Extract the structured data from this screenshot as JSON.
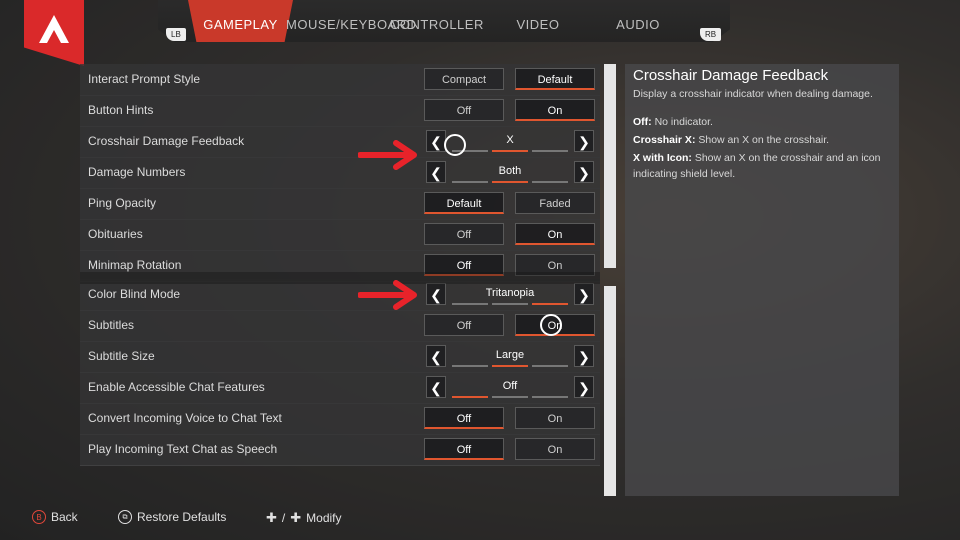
{
  "tabs": [
    {
      "label": "GAMEPLAY",
      "active": true
    },
    {
      "label": "MOUSE/KEYBOARD",
      "active": false
    },
    {
      "label": "CONTROLLER",
      "active": false
    },
    {
      "label": "VIDEO",
      "active": false
    },
    {
      "label": "AUDIO",
      "active": false
    }
  ],
  "bumpers": {
    "left": "LB",
    "right": "RB"
  },
  "settings": [
    {
      "label": "Interact Prompt Style",
      "type": "toggle",
      "options": [
        "Compact",
        "Default"
      ],
      "selected": 1
    },
    {
      "label": "Button Hints",
      "type": "toggle",
      "options": [
        "Off",
        "On"
      ],
      "selected": 1
    },
    {
      "label": "Crosshair Damage Feedback",
      "type": "cycle",
      "value": "X",
      "segments": 3,
      "active_segment": 1
    },
    {
      "label": "Damage Numbers",
      "type": "cycle",
      "value": "Both",
      "segments": 3,
      "active_segment": 1
    },
    {
      "label": "Ping Opacity",
      "type": "toggle",
      "options": [
        "Default",
        "Faded"
      ],
      "selected": 0
    },
    {
      "label": "Obituaries",
      "type": "toggle",
      "options": [
        "Off",
        "On"
      ],
      "selected": 1
    },
    {
      "label": "Minimap Rotation",
      "type": "toggle",
      "options": [
        "Off",
        "On"
      ],
      "selected": 0
    },
    {
      "label": "Color Blind Mode",
      "type": "cycle",
      "value": "Tritanopia",
      "segments": 3,
      "active_segment": 2
    },
    {
      "label": "Subtitles",
      "type": "toggle",
      "options": [
        "Off",
        "On"
      ],
      "selected": 1
    },
    {
      "label": "Subtitle Size",
      "type": "cycle",
      "value": "Large",
      "segments": 3,
      "active_segment": 1
    },
    {
      "label": "Enable Accessible Chat Features",
      "type": "cycle",
      "value": "Off",
      "segments": 3,
      "active_segment": 0
    },
    {
      "label": "Convert Incoming Voice to Chat Text",
      "type": "toggle",
      "options": [
        "Off",
        "On"
      ],
      "selected": 0
    },
    {
      "label": "Play Incoming Text Chat as Speech",
      "type": "toggle",
      "options": [
        "Off",
        "On"
      ],
      "selected": 0
    }
  ],
  "info": {
    "title": "Crosshair Damage Feedback",
    "description": "Display a crosshair indicator when dealing damage.",
    "lines": [
      {
        "key": "Off:",
        "text": " No indicator."
      },
      {
        "key": "Crosshair X:",
        "text": " Show an X on the crosshair."
      },
      {
        "key": "X with Icon:",
        "text": " Show an X on the crosshair and an icon indicating shield level."
      }
    ]
  },
  "footer": {
    "back_button": "B",
    "back": "Back",
    "restore": "Restore Defaults",
    "modify": "Modify",
    "modify_separator": "/"
  },
  "colors": {
    "accent": "#c9392a",
    "highlight": "#e0562f",
    "annotation": "#e8232a"
  },
  "icons": {
    "logo": "apex-logo-icon",
    "restore": "controller-view-icon",
    "modify": "dpad-icon"
  }
}
